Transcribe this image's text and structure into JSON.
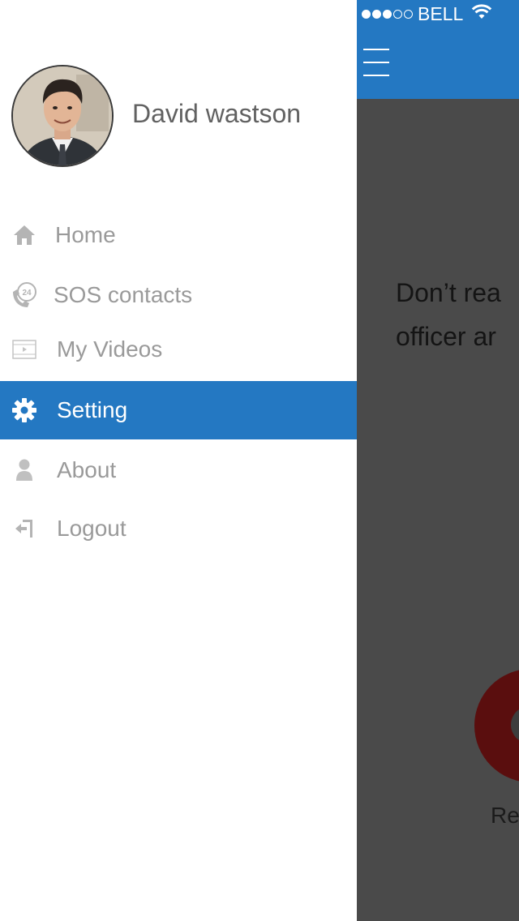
{
  "status_bar": {
    "signal_filled": 3,
    "signal_total": 5,
    "carrier": "BELL"
  },
  "main": {
    "message_line1": "Don’t rea",
    "message_line2": "officer ar",
    "record_label": "Re"
  },
  "drawer": {
    "user_name": "David wastson",
    "items": [
      {
        "label": "Home",
        "icon": "home-icon"
      },
      {
        "label": "SOS contacts",
        "icon": "phone-24-icon"
      },
      {
        "label": "My Videos",
        "icon": "video-icon"
      },
      {
        "label": "Setting",
        "icon": "gear-icon",
        "active": true
      },
      {
        "label": "About",
        "icon": "person-icon"
      },
      {
        "label": "Logout",
        "icon": "logout-icon"
      }
    ]
  },
  "colors": {
    "accent": "#2478c2",
    "overlay": "#4a4a4a",
    "menu_text": "#9a9a9a",
    "record_button": "#5a0e0e"
  }
}
